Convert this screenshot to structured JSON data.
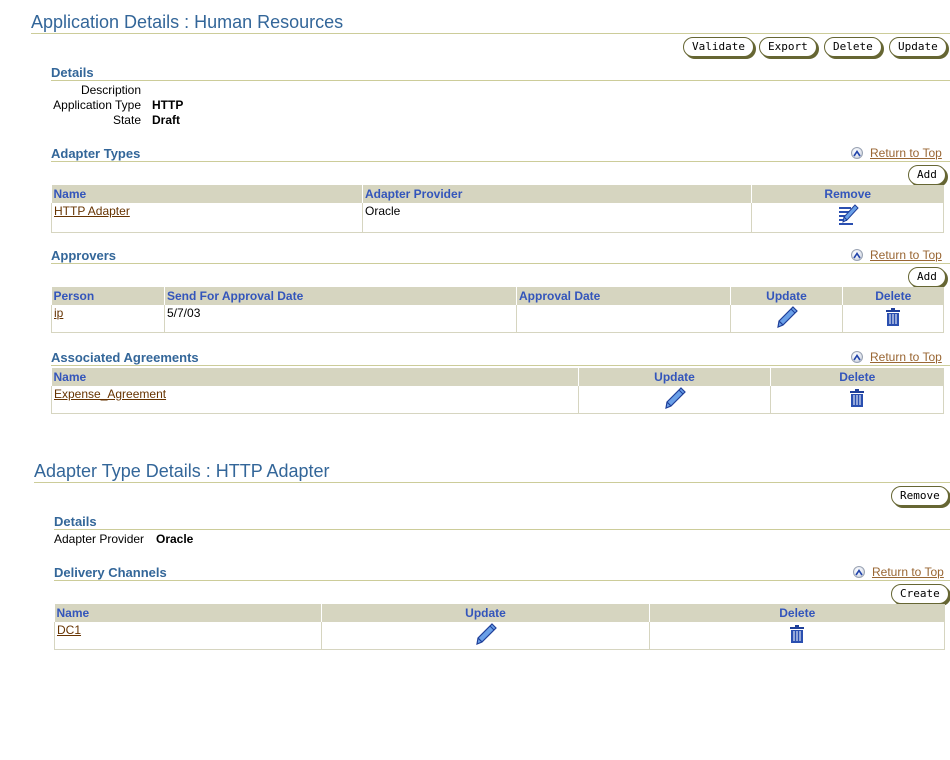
{
  "app_details": {
    "title": "Application Details : Human Resources",
    "buttons": {
      "validate": "Validate",
      "export": "Export",
      "delete": "Delete",
      "update": "Update"
    },
    "details": {
      "heading": "Details",
      "fields": [
        {
          "label": "Description",
          "value": ""
        },
        {
          "label": "Application Type",
          "value": "HTTP"
        },
        {
          "label": "State",
          "value": "Draft"
        }
      ]
    },
    "return_to_top": "Return to Top",
    "adapter_types": {
      "heading": "Adapter Types",
      "add_label": "Add",
      "columns": [
        "Name",
        "Adapter Provider",
        "Remove"
      ],
      "rows": [
        {
          "name": "HTTP Adapter",
          "provider": "Oracle",
          "remove_icon": "remove-icon"
        }
      ]
    },
    "approvers": {
      "heading": "Approvers",
      "add_label": "Add",
      "columns": [
        "Person",
        "Send For Approval Date",
        "Approval Date",
        "Update",
        "Delete"
      ],
      "rows": [
        {
          "person": "ip",
          "send_date": "5/7/03",
          "approval_date": "",
          "update_icon": "pencil-icon",
          "delete_icon": "trash-icon"
        }
      ]
    },
    "agreements": {
      "heading": "Associated Agreements",
      "columns": [
        "Name",
        "Update",
        "Delete"
      ],
      "rows": [
        {
          "name": "Expense_Agreement",
          "update_icon": "pencil-icon",
          "delete_icon": "trash-icon"
        }
      ]
    }
  },
  "adapter_type_details": {
    "title": "Adapter Type Details : HTTP Adapter",
    "remove_label": "Remove",
    "details": {
      "heading": "Details",
      "fields": [
        {
          "label": "Adapter Provider",
          "value": "Oracle"
        }
      ]
    },
    "delivery_channels": {
      "heading": "Delivery Channels",
      "create_label": "Create",
      "columns": [
        "Name",
        "Update",
        "Delete"
      ],
      "rows": [
        {
          "name": "DC1",
          "update_icon": "pencil-icon",
          "delete_icon": "trash-icon"
        }
      ]
    }
  },
  "colors": {
    "title": "#336699",
    "header_bg": "#d6d5c0",
    "header_text": "#3355bb",
    "link": "#663300",
    "return_link": "#996633",
    "rule": "#cccc99"
  }
}
